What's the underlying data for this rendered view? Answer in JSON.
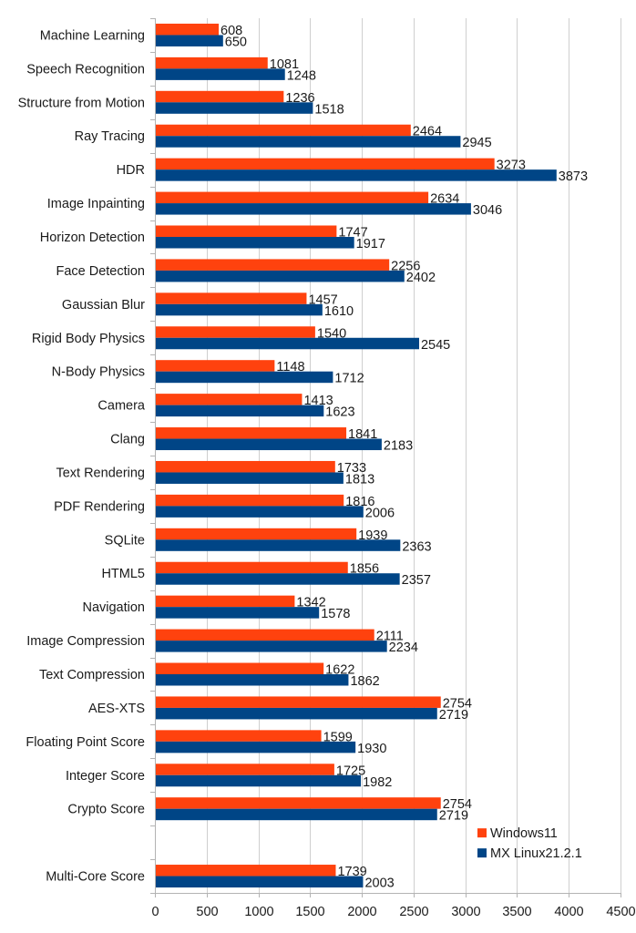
{
  "chart_data": {
    "type": "bar",
    "orientation": "horizontal",
    "title": "",
    "xlabel": "",
    "ylabel": "",
    "xlim": [
      0,
      4500
    ],
    "x_ticks": [
      0,
      500,
      1000,
      1500,
      2000,
      2500,
      3000,
      3500,
      4000,
      4500
    ],
    "grid": true,
    "legend_position": "bottom-right",
    "categories": [
      "Machine Learning",
      "Speech Recognition",
      "Structure from Motion",
      "Ray Tracing",
      "HDR",
      "Image Inpainting",
      "Horizon Detection",
      "Face Detection",
      "Gaussian Blur",
      "Rigid Body Physics",
      "N-Body Physics",
      "Camera",
      "Clang",
      "Text Rendering",
      "PDF Rendering",
      "SQLite",
      "HTML5",
      "Navigation",
      "Image Compression",
      "Text Compression",
      "AES-XTS",
      "Floating Point Score",
      "Integer Score",
      "Crypto Score",
      "",
      "Multi-Core Score"
    ],
    "series": [
      {
        "name": "Windows11",
        "color": "#ff420e",
        "values": [
          608,
          1081,
          1236,
          2464,
          3273,
          2634,
          1747,
          2256,
          1457,
          1540,
          1148,
          1413,
          1841,
          1733,
          1816,
          1939,
          1856,
          1342,
          2111,
          1622,
          2754,
          1599,
          1725,
          2754,
          null,
          1739
        ]
      },
      {
        "name": "MX Linux21.2.1",
        "color": "#004586",
        "values": [
          650,
          1248,
          1518,
          2945,
          3873,
          3046,
          1917,
          2402,
          1610,
          2545,
          1712,
          1623,
          2183,
          1813,
          2006,
          2363,
          2357,
          1578,
          2234,
          1862,
          2719,
          1930,
          1982,
          2719,
          null,
          2003
        ]
      }
    ]
  }
}
